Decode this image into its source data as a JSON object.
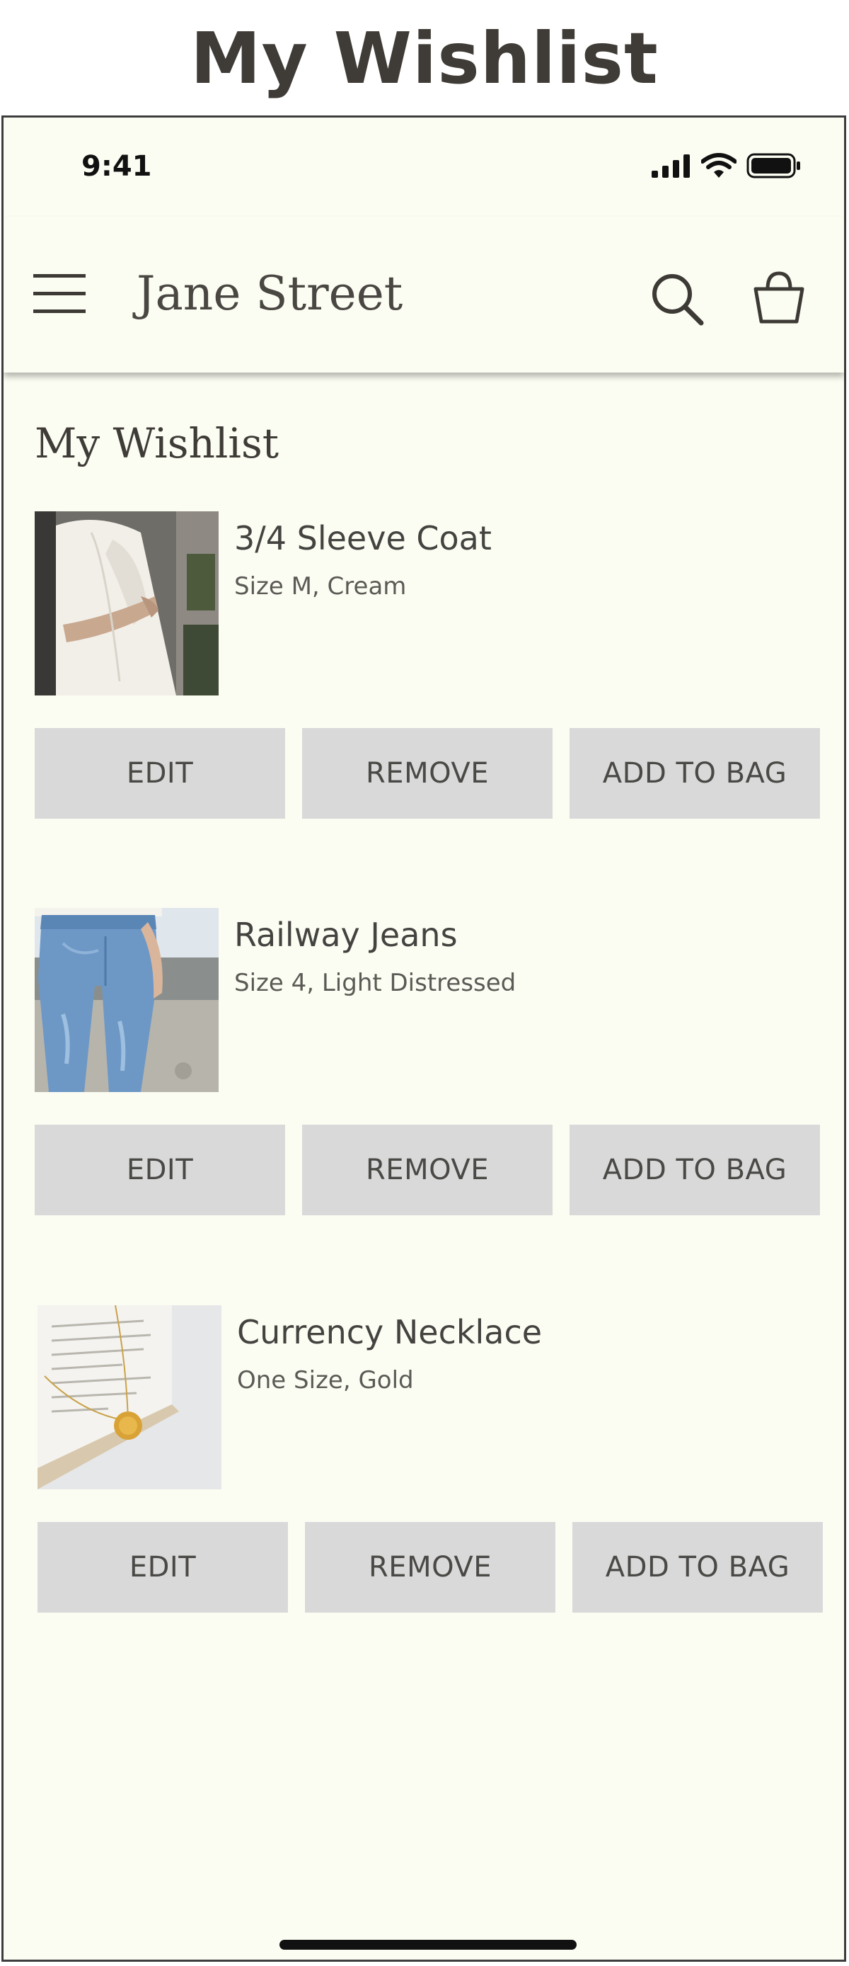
{
  "page": {
    "title": "My Wishlist"
  },
  "status_bar": {
    "time": "9:41",
    "icons": [
      "cellular-signal-icon",
      "wifi-icon",
      "battery-icon"
    ]
  },
  "header": {
    "brand": "Jane Street",
    "menu_icon": "hamburger-menu-icon",
    "search_icon": "search-icon",
    "bag_icon": "shopping-bag-icon"
  },
  "wishlist": {
    "heading": "My Wishlist",
    "items": [
      {
        "name": "3/4 Sleeve Coat",
        "detail": "Size M, Cream",
        "edit_label": "EDIT",
        "remove_label": "REMOVE",
        "add_label": "ADD TO BAG"
      },
      {
        "name": "Railway Jeans",
        "detail": "Size 4, Light Distressed",
        "edit_label": "EDIT",
        "remove_label": "REMOVE",
        "add_label": "ADD TO BAG"
      },
      {
        "name": "Currency Necklace",
        "detail": "One Size, Gold",
        "edit_label": "EDIT",
        "remove_label": "REMOVE",
        "add_label": "ADD TO BAG"
      }
    ]
  },
  "colors": {
    "screen_background": "#fcfdf2",
    "button_background": "#d9d9d9",
    "text_primary": "#454340"
  }
}
